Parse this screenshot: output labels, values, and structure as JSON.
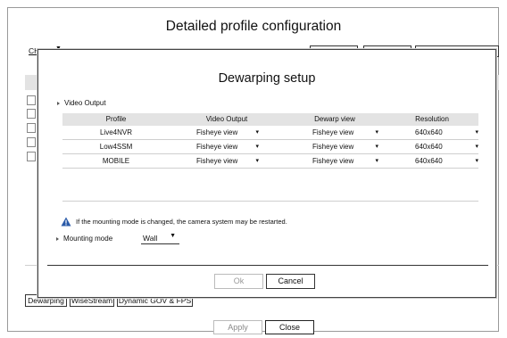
{
  "page": {
    "title": "Detailed profile configuration"
  },
  "toolbar": {
    "channel": "CH 02",
    "add_label": "Add",
    "delete_label": "Delete",
    "apply_label": "Apply to other channels"
  },
  "tabs": [
    "Dewarping",
    "WiseStream",
    "Dynamic GOV & FPS"
  ],
  "footer": {
    "apply_label": "Apply",
    "close_label": "Close"
  },
  "dialog": {
    "title": "Dewarping setup",
    "section_label": "Video Output",
    "columns": [
      "Profile",
      "Video Output",
      "Dewarp view",
      "Resolution"
    ],
    "rows": [
      {
        "profile": "Live4NVR",
        "video_output": "Fisheye view",
        "dewarp_view": "Fisheye view",
        "resolution": "640x640"
      },
      {
        "profile": "Low4SSM",
        "video_output": "Fisheye view",
        "dewarp_view": "Fisheye view",
        "resolution": "640x640"
      },
      {
        "profile": "MOBILE",
        "video_output": "Fisheye view",
        "dewarp_view": "Fisheye view",
        "resolution": "640x640"
      }
    ],
    "warning_text": "If the mounting mode is changed, the camera system may be restarted.",
    "mounting_label": "Mounting mode",
    "mounting_value": "Wall",
    "ok_label": "Ok",
    "cancel_label": "Cancel"
  },
  "colors": {
    "header_band": "#e3e3e3",
    "warning_icon": "#2a5aa8",
    "border": "#333333"
  }
}
